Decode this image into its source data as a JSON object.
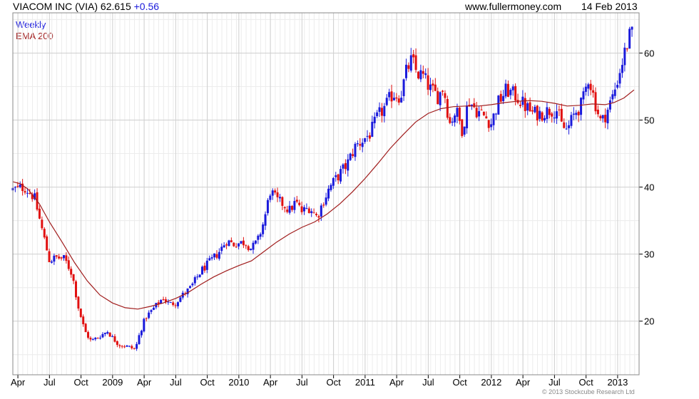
{
  "header": {
    "security": "VIACOM INC (VIA)",
    "last": "62.615",
    "change": "+0.56",
    "site": "www.fullermoney.com",
    "date": "14 Feb 2013"
  },
  "legend": {
    "weekly": "Weekly",
    "ema": "EMA 200"
  },
  "copyright": "© 2013 Stockcube Research Ltd",
  "colors": {
    "up": "#1a1adb",
    "down": "#e01010",
    "ema": "#a01c1c",
    "grid": "#cfcfcf",
    "frame": "#888888"
  },
  "chart_data": {
    "type": "candlestick",
    "title": "VIACOM INC (VIA) 62.615 +0.56",
    "period": "Weekly",
    "ylim": [
      12,
      66
    ],
    "yticks": [
      20,
      30,
      40,
      50,
      60
    ],
    "xlim": [
      2008.21,
      2013.17
    ],
    "xticks": [
      {
        "label": "Apr",
        "t": 2008.25
      },
      {
        "label": "Jul",
        "t": 2008.5
      },
      {
        "label": "Oct",
        "t": 2008.75
      },
      {
        "label": "2009",
        "t": 2009.0
      },
      {
        "label": "Apr",
        "t": 2009.25
      },
      {
        "label": "Jul",
        "t": 2009.5
      },
      {
        "label": "Oct",
        "t": 2009.75
      },
      {
        "label": "2010",
        "t": 2010.0
      },
      {
        "label": "Apr",
        "t": 2010.25
      },
      {
        "label": "Jul",
        "t": 2010.5
      },
      {
        "label": "Oct",
        "t": 2010.75
      },
      {
        "label": "2011",
        "t": 2011.0
      },
      {
        "label": "Apr",
        "t": 2011.25
      },
      {
        "label": "Jul",
        "t": 2011.5
      },
      {
        "label": "Oct",
        "t": 2011.75
      },
      {
        "label": "2012",
        "t": 2012.0
      },
      {
        "label": "Apr",
        "t": 2012.25
      },
      {
        "label": "Jul",
        "t": 2012.5
      },
      {
        "label": "Oct",
        "t": 2012.75
      },
      {
        "label": "2013",
        "t": 2013.0
      }
    ],
    "price_path": [
      [
        2008.21,
        39.6
      ],
      [
        2008.3,
        40.0
      ],
      [
        2008.38,
        38.5
      ],
      [
        2008.45,
        33.0
      ],
      [
        2008.5,
        29.0
      ],
      [
        2008.55,
        29.5
      ],
      [
        2008.62,
        29.3
      ],
      [
        2008.68,
        27.0
      ],
      [
        2008.73,
        22.0
      ],
      [
        2008.78,
        18.5
      ],
      [
        2008.83,
        17.0
      ],
      [
        2008.9,
        17.8
      ],
      [
        2008.96,
        18.5
      ],
      [
        2009.0,
        17.5
      ],
      [
        2009.05,
        16.5
      ],
      [
        2009.12,
        16.2
      ],
      [
        2009.18,
        15.8
      ],
      [
        2009.22,
        18.5
      ],
      [
        2009.26,
        20.5
      ],
      [
        2009.33,
        22.0
      ],
      [
        2009.4,
        23.5
      ],
      [
        2009.45,
        22.5
      ],
      [
        2009.5,
        22.8
      ],
      [
        2009.55,
        23.8
      ],
      [
        2009.62,
        25.0
      ],
      [
        2009.7,
        27.5
      ],
      [
        2009.78,
        29.0
      ],
      [
        2009.85,
        30.5
      ],
      [
        2009.9,
        32.0
      ],
      [
        2009.96,
        31.5
      ],
      [
        2010.05,
        31.8
      ],
      [
        2010.1,
        30.8
      ],
      [
        2010.15,
        32.0
      ],
      [
        2010.2,
        35.0
      ],
      [
        2010.25,
        39.5
      ],
      [
        2010.3,
        38.0
      ],
      [
        2010.35,
        37.5
      ],
      [
        2010.4,
        36.5
      ],
      [
        2010.45,
        37.8
      ],
      [
        2010.5,
        36.3
      ],
      [
        2010.56,
        37.0
      ],
      [
        2010.62,
        35.5
      ],
      [
        2010.66,
        37.5
      ],
      [
        2010.72,
        40.0
      ],
      [
        2010.8,
        42.0
      ],
      [
        2010.86,
        43.5
      ],
      [
        2010.92,
        46.0
      ],
      [
        2010.98,
        47.0
      ],
      [
        2011.04,
        48.0
      ],
      [
        2011.1,
        50.5
      ],
      [
        2011.16,
        52.0
      ],
      [
        2011.22,
        54.0
      ],
      [
        2011.28,
        53.5
      ],
      [
        2011.33,
        57.5
      ],
      [
        2011.37,
        59.0
      ],
      [
        2011.41,
        57.0
      ],
      [
        2011.46,
        56.5
      ],
      [
        2011.52,
        54.5
      ],
      [
        2011.58,
        53.5
      ],
      [
        2011.62,
        55.0
      ],
      [
        2011.67,
        49.5
      ],
      [
        2011.72,
        51.5
      ],
      [
        2011.77,
        48.5
      ],
      [
        2011.82,
        53.0
      ],
      [
        2011.88,
        51.5
      ],
      [
        2011.95,
        50.5
      ],
      [
        2012.0,
        49.5
      ],
      [
        2012.05,
        52.5
      ],
      [
        2012.12,
        54.5
      ],
      [
        2012.2,
        53.5
      ],
      [
        2012.27,
        52.0
      ],
      [
        2012.33,
        51.0
      ],
      [
        2012.4,
        51.0
      ],
      [
        2012.46,
        51.5
      ],
      [
        2012.52,
        51.5
      ],
      [
        2012.56,
        49.0
      ],
      [
        2012.6,
        48.5
      ],
      [
        2012.66,
        51.0
      ],
      [
        2012.72,
        52.5
      ],
      [
        2012.77,
        56.5
      ],
      [
        2012.83,
        52.0
      ],
      [
        2012.87,
        49.5
      ],
      [
        2012.92,
        51.5
      ],
      [
        2012.97,
        54.0
      ],
      [
        2013.02,
        57.5
      ],
      [
        2013.07,
        61.0
      ],
      [
        2013.1,
        62.8
      ],
      [
        2013.13,
        62.6
      ]
    ],
    "series": [
      {
        "name": "EMA 200",
        "points": [
          [
            2008.21,
            40.8
          ],
          [
            2008.27,
            40.5
          ],
          [
            2008.33,
            39.7
          ],
          [
            2008.42,
            37.5
          ],
          [
            2008.5,
            34.8
          ],
          [
            2008.6,
            31.8
          ],
          [
            2008.7,
            28.7
          ],
          [
            2008.8,
            26.0
          ],
          [
            2008.9,
            23.9
          ],
          [
            2009.0,
            22.7
          ],
          [
            2009.1,
            22.0
          ],
          [
            2009.2,
            21.8
          ],
          [
            2009.3,
            22.2
          ],
          [
            2009.4,
            22.7
          ],
          [
            2009.5,
            23.4
          ],
          [
            2009.6,
            24.3
          ],
          [
            2009.7,
            25.5
          ],
          [
            2009.8,
            26.6
          ],
          [
            2009.9,
            27.5
          ],
          [
            2010.0,
            28.3
          ],
          [
            2010.1,
            29.0
          ],
          [
            2010.2,
            30.4
          ],
          [
            2010.3,
            31.8
          ],
          [
            2010.4,
            33.0
          ],
          [
            2010.5,
            34.0
          ],
          [
            2010.6,
            34.8
          ],
          [
            2010.7,
            36.0
          ],
          [
            2010.8,
            37.5
          ],
          [
            2010.9,
            39.3
          ],
          [
            2011.0,
            41.3
          ],
          [
            2011.1,
            43.5
          ],
          [
            2011.2,
            45.8
          ],
          [
            2011.3,
            47.8
          ],
          [
            2011.4,
            49.7
          ],
          [
            2011.5,
            51.0
          ],
          [
            2011.6,
            51.7
          ],
          [
            2011.7,
            52.0
          ],
          [
            2011.8,
            52.1
          ],
          [
            2011.9,
            52.1
          ],
          [
            2012.0,
            52.3
          ],
          [
            2012.1,
            52.6
          ],
          [
            2012.2,
            52.8
          ],
          [
            2012.3,
            52.9
          ],
          [
            2012.4,
            52.8
          ],
          [
            2012.5,
            52.5
          ],
          [
            2012.6,
            52.1
          ],
          [
            2012.7,
            52.2
          ],
          [
            2012.8,
            52.4
          ],
          [
            2012.9,
            52.3
          ],
          [
            2012.97,
            52.6
          ],
          [
            2013.05,
            53.3
          ],
          [
            2013.13,
            54.5
          ]
        ]
      }
    ]
  }
}
